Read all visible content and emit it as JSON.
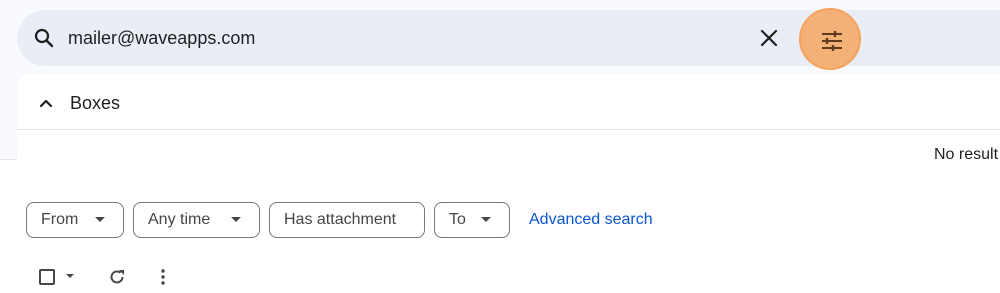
{
  "search": {
    "query": "mailer@waveapps.com",
    "icon": "search-icon",
    "clear_icon": "close-icon",
    "filter_icon": "tune-icon",
    "filter_highlight_color": "#f5a25d"
  },
  "dropdown": {
    "section_label": "Boxes",
    "section_icon": "chevron-up-icon",
    "no_results_text": "No result"
  },
  "filters": {
    "chips": [
      {
        "label": "From",
        "has_caret": true
      },
      {
        "label": "Any time",
        "has_caret": true
      },
      {
        "label": "Has attachment",
        "has_caret": false
      },
      {
        "label": "To",
        "has_caret": true
      }
    ],
    "advanced_link": "Advanced search"
  },
  "toolbar": {
    "select_icon": "checkbox-icon",
    "select_caret_icon": "caret-down-icon",
    "refresh_icon": "refresh-icon",
    "more_icon": "more-vert-icon"
  },
  "colors": {
    "accent_link": "#0b57d0",
    "search_bg": "#e9eef6"
  }
}
